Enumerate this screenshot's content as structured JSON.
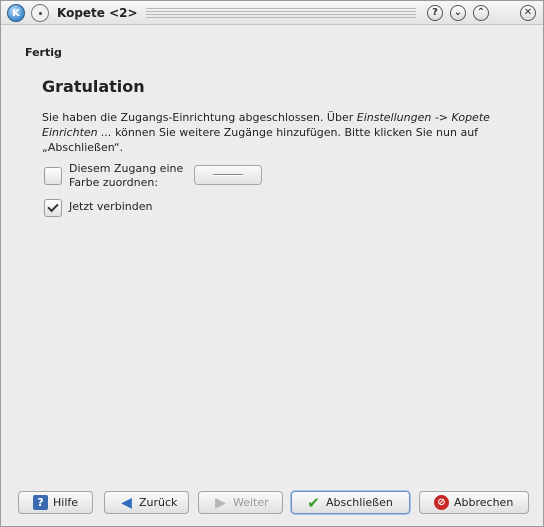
{
  "window": {
    "title": "Kopete <2>"
  },
  "page": {
    "step_title": "Fertig",
    "heading": "Gratulation",
    "description_part1": "Sie haben die Zugangs-Einrichtung abgeschlossen. Über ",
    "description_italic": "Einstellungen -> Kopete Einrichten ...",
    "description_part2": " können Sie weitere Zugänge hinzufügen. Bitte klicken Sie nun auf „Abschließen“."
  },
  "options": {
    "color_label": "Diesem Zugang eine Farbe zuordnen:",
    "color_checked": false,
    "connect_label": "Jetzt verbinden",
    "connect_checked": true
  },
  "buttons": {
    "help": "Hilfe",
    "back": "Zurück",
    "next": "Weiter",
    "finish": "Abschließen",
    "cancel": "Abbrechen"
  },
  "icons": {
    "app": "kopete-app-icon",
    "help": "help-icon",
    "back": "arrow-left-icon",
    "next": "arrow-right-icon",
    "finish": "checkmark-icon",
    "cancel": "cancel-icon"
  },
  "colors": {
    "finish_accent": "#3d9b2e",
    "cancel_accent": "#c82828",
    "back_accent": "#2f6bc0"
  }
}
